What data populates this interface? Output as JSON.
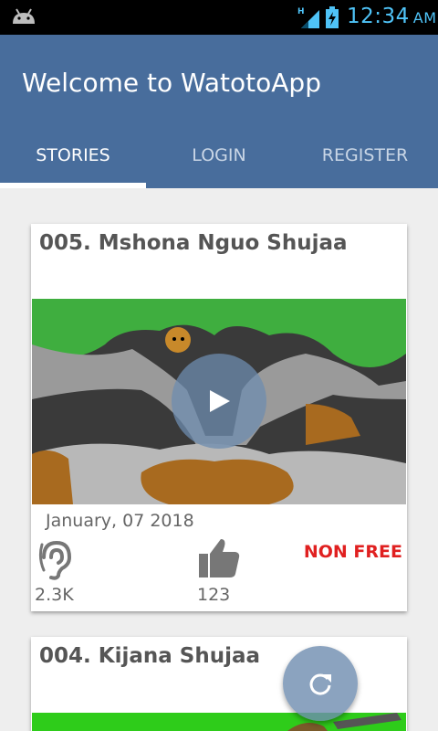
{
  "status_bar": {
    "time": "12:34",
    "ampm": "AM",
    "network": "H"
  },
  "app_bar": {
    "title": "Welcome to WatotoApp"
  },
  "tabs": [
    {
      "label": "STORIES",
      "active": true
    },
    {
      "label": "LOGIN",
      "active": false
    },
    {
      "label": "REGISTER",
      "active": false
    }
  ],
  "stories": [
    {
      "title": "005. Mshona Nguo Shujaa",
      "date": "January, 07 2018",
      "listens": "2.3K",
      "likes": "123",
      "price_label": "NON FREE",
      "thumbnail_icon": "cartoon-scene"
    },
    {
      "title": "004. Kijana Shujaa"
    }
  ],
  "icons": {
    "status": [
      "android-icon",
      "signal-icon",
      "battery-icon"
    ],
    "card": [
      "play-icon",
      "hearing-icon",
      "thumb-up-icon"
    ],
    "fab": "refresh-icon"
  },
  "colors": {
    "app_bar": "#486d9c",
    "accent_red": "#e02020",
    "clock": "#4fc3f7"
  }
}
